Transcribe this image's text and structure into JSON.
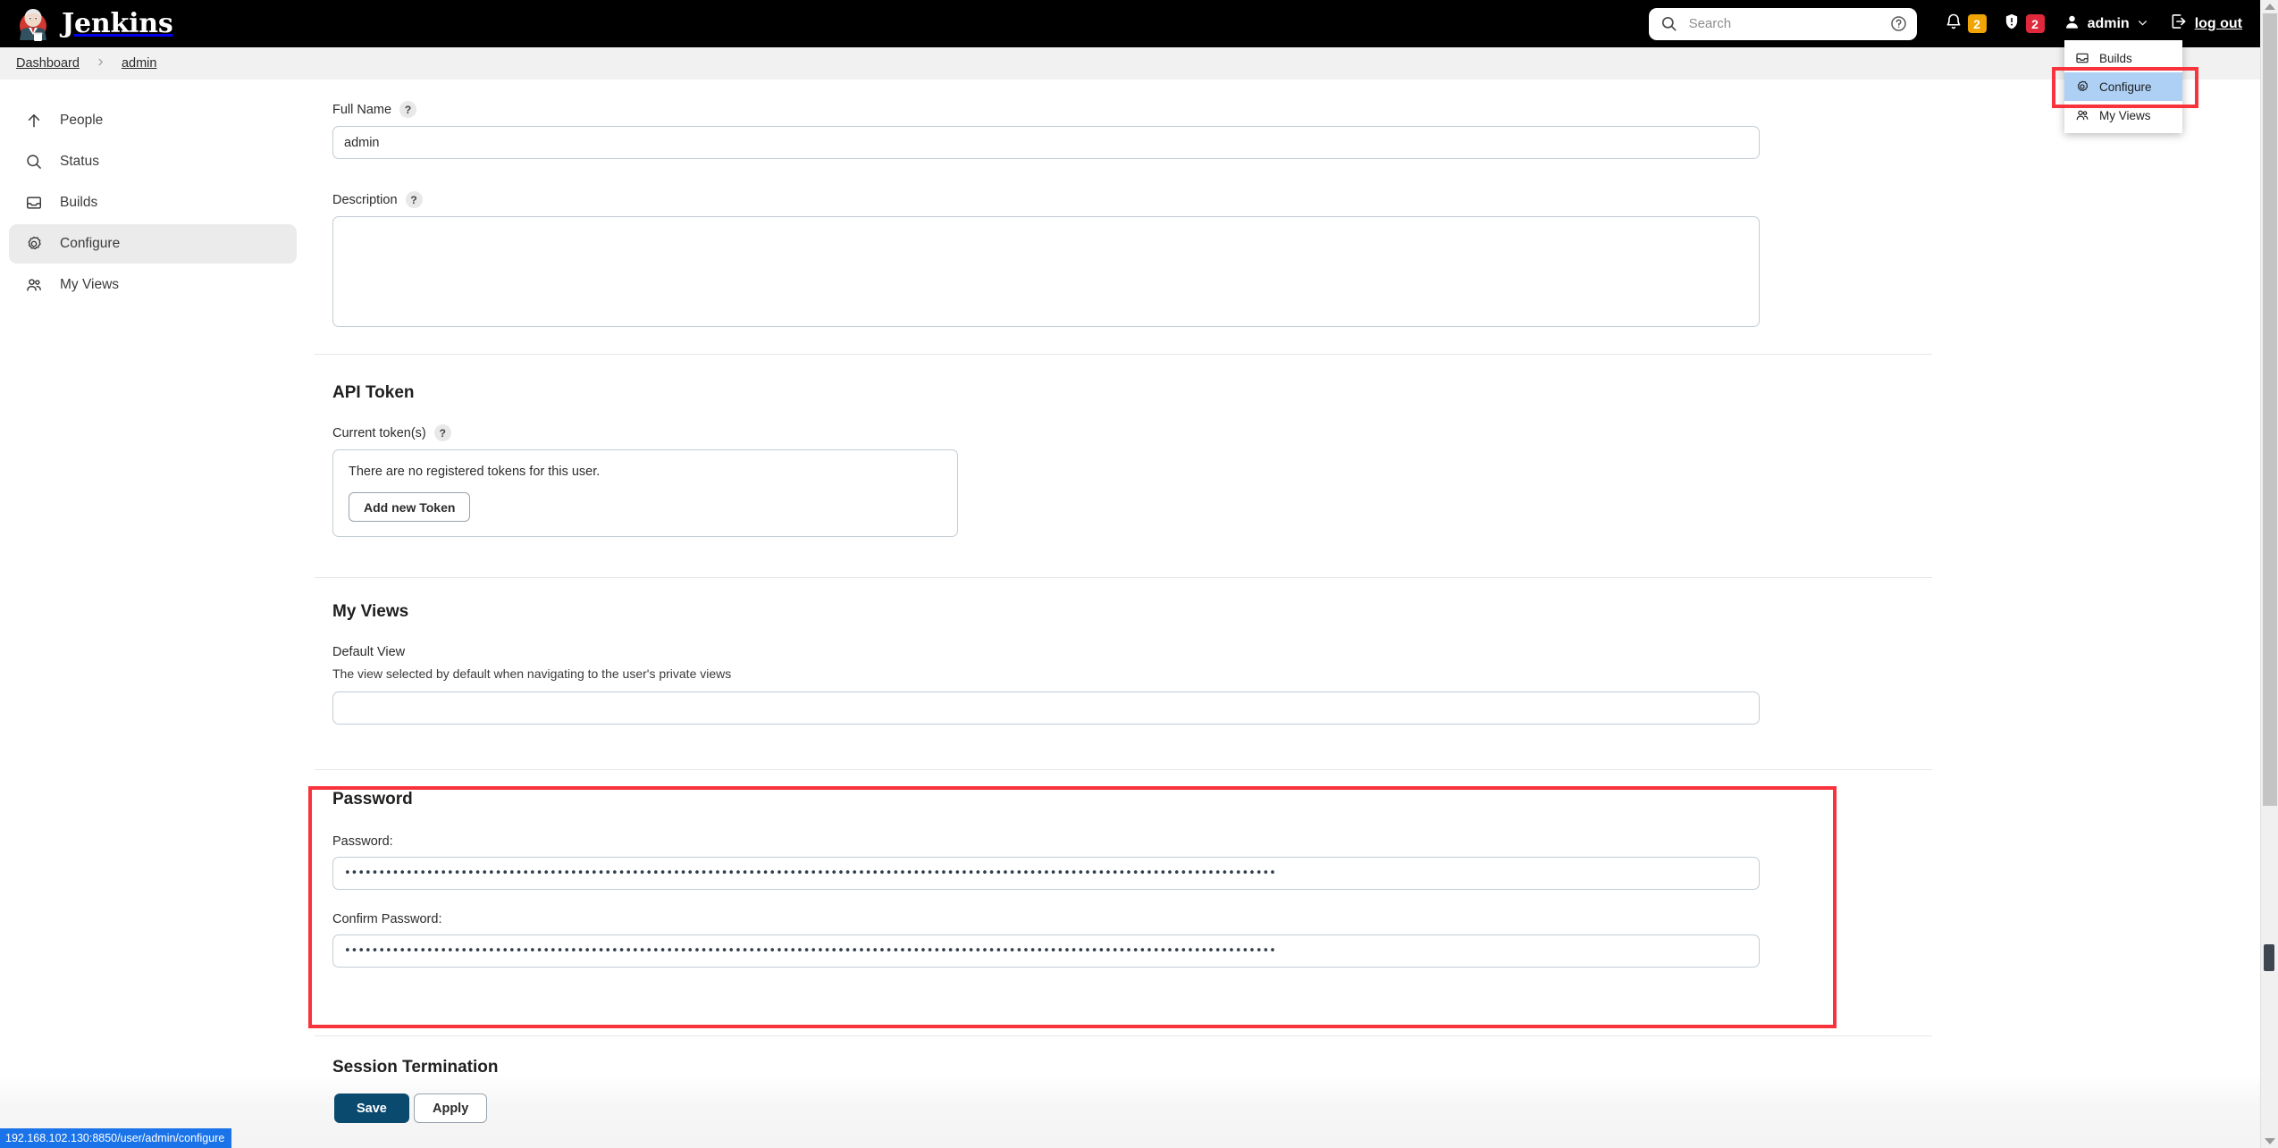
{
  "app": {
    "brand": "Jenkins",
    "logo_icon": "jenkins-butler-logo"
  },
  "header": {
    "search": {
      "placeholder": "Search",
      "value": "",
      "icon": "search-icon",
      "help_icon": "question-circle-icon"
    },
    "notifications": {
      "icon": "bell-icon",
      "count": "2",
      "color": "#f0a505"
    },
    "security": {
      "icon": "shield-exclamation-icon",
      "count": "2",
      "color": "#e0283c"
    },
    "user": {
      "icon": "person-icon",
      "label": "admin",
      "chevron": "chevron-down-icon"
    },
    "logout": {
      "icon": "logout-arrow-icon",
      "label": "log out"
    }
  },
  "user_dropdown": {
    "items": [
      {
        "label": "Builds",
        "icon": "inbox-icon",
        "selected": false
      },
      {
        "label": "Configure",
        "icon": "gear-icon",
        "selected": true
      },
      {
        "label": "My Views",
        "icon": "people-icon",
        "selected": false
      }
    ]
  },
  "breadcrumb": {
    "items": [
      "Dashboard",
      "admin"
    ],
    "separator": "›"
  },
  "sidebar": {
    "items": [
      {
        "label": "People",
        "icon": "arrow-up-icon",
        "active": false
      },
      {
        "label": "Status",
        "icon": "search-icon",
        "active": false
      },
      {
        "label": "Builds",
        "icon": "inbox-icon",
        "active": false
      },
      {
        "label": "Configure",
        "icon": "gear-icon",
        "active": true
      },
      {
        "label": "My Views",
        "icon": "people-icon",
        "active": false
      }
    ]
  },
  "form": {
    "full_name": {
      "label": "Full Name",
      "help": "?",
      "value": "admin"
    },
    "description": {
      "label": "Description",
      "help": "?",
      "value": ""
    },
    "api_token": {
      "title": "API Token",
      "current_tokens_label": "Current token(s)",
      "help": "?",
      "empty_message": "There are no registered tokens for this user.",
      "add_button": "Add new Token"
    },
    "my_views": {
      "title": "My Views",
      "default_view_label": "Default View",
      "default_view_help": "The view selected by default when navigating to the user's private views",
      "default_view_value": ""
    },
    "password": {
      "title": "Password",
      "password_label": "Password:",
      "password_value": "••••••••••••••••••••••••••••••••••••••••••••••••••••••••••••••••••••••••••••••••••••••••••••••••••••••••••••••••••••••••••••••••••••••••",
      "confirm_label": "Confirm Password:",
      "confirm_value": "••••••••••••••••••••••••••••••••••••••••••••••••••••••••••••••••••••••••••••••••••••••••••••••••••••••••••••••••••••••••••••••••••••••••"
    },
    "session_termination": {
      "title": "Session Termination"
    }
  },
  "actions": {
    "save": "Save",
    "apply": "Apply"
  },
  "status_bar": {
    "url": "192.168.102.130:8850/user/admin/configure"
  },
  "annotations": {
    "accent_color": "#f9333c",
    "highlight_color": "#aed0f5"
  }
}
